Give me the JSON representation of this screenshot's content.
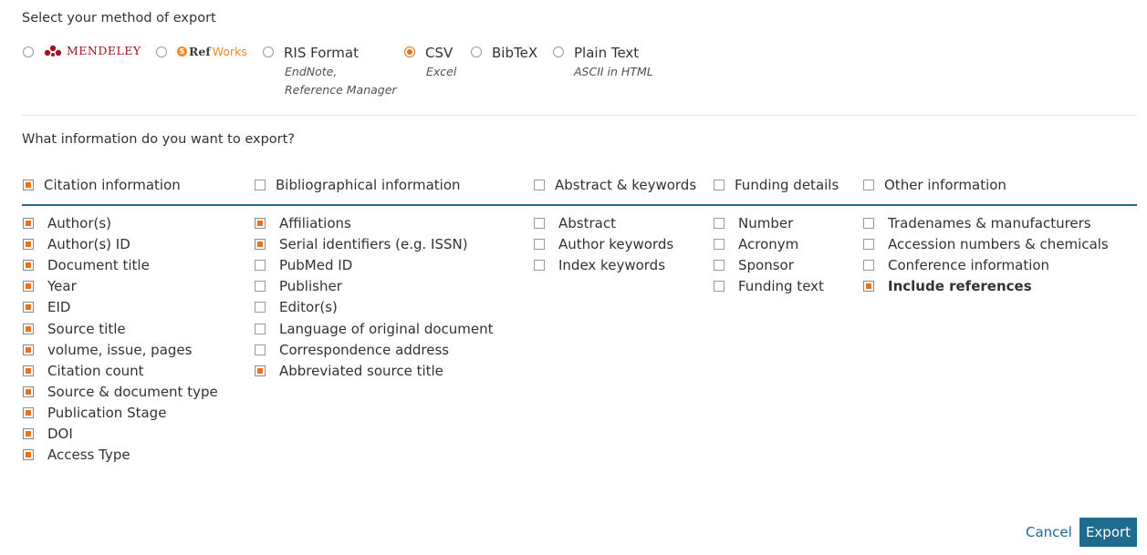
{
  "method_section": {
    "title": "Select your method of export",
    "methods": [
      {
        "id": "mendeley",
        "label": "MENDELEY",
        "selected": false
      },
      {
        "id": "refworks",
        "label_ref": "Ref",
        "label_works": "Works",
        "selected": false
      },
      {
        "id": "ris",
        "label": "RIS Format",
        "sub1": "EndNote,",
        "sub2": "Reference Manager",
        "selected": false
      },
      {
        "id": "csv",
        "label": "CSV",
        "sub1": "Excel",
        "selected": true
      },
      {
        "id": "bibtex",
        "label": "BibTeX",
        "selected": false
      },
      {
        "id": "plaintext",
        "label": "Plain Text",
        "sub1": "ASCII in HTML",
        "selected": false
      }
    ]
  },
  "info_section": {
    "title": "What information do you want to export?",
    "columns": [
      {
        "header": "Citation information",
        "checked": true,
        "items": [
          {
            "label": "Author(s)",
            "checked": true
          },
          {
            "label": "Author(s) ID",
            "checked": true
          },
          {
            "label": "Document title",
            "checked": true
          },
          {
            "label": "Year",
            "checked": true
          },
          {
            "label": "EID",
            "checked": true
          },
          {
            "label": "Source title",
            "checked": true
          },
          {
            "label": "volume, issue, pages",
            "checked": true
          },
          {
            "label": "Citation count",
            "checked": true
          },
          {
            "label": "Source & document type",
            "checked": true
          },
          {
            "label": "Publication Stage",
            "checked": true
          },
          {
            "label": "DOI",
            "checked": true
          },
          {
            "label": "Access Type",
            "checked": true
          }
        ]
      },
      {
        "header": "Bibliographical information",
        "checked": false,
        "items": [
          {
            "label": "Affiliations",
            "checked": true
          },
          {
            "label": "Serial identifiers (e.g. ISSN)",
            "checked": true
          },
          {
            "label": "PubMed ID",
            "checked": false
          },
          {
            "label": "Publisher",
            "checked": false
          },
          {
            "label": "Editor(s)",
            "checked": false
          },
          {
            "label": "Language of original document",
            "checked": false
          },
          {
            "label": "Correspondence address",
            "checked": false
          },
          {
            "label": "Abbreviated source title",
            "checked": true
          }
        ]
      },
      {
        "header": "Abstract & keywords",
        "checked": false,
        "items": [
          {
            "label": "Abstract",
            "checked": false
          },
          {
            "label": "Author keywords",
            "checked": false
          },
          {
            "label": "Index keywords",
            "checked": false
          }
        ]
      },
      {
        "header": "Funding details",
        "checked": false,
        "items": [
          {
            "label": "Number",
            "checked": false
          },
          {
            "label": "Acronym",
            "checked": false
          },
          {
            "label": "Sponsor",
            "checked": false
          },
          {
            "label": "Funding text",
            "checked": false
          }
        ]
      },
      {
        "header": "Other information",
        "checked": false,
        "items": [
          {
            "label": "Tradenames & manufacturers",
            "checked": false
          },
          {
            "label": "Accession numbers & chemicals",
            "checked": false
          },
          {
            "label": "Conference information",
            "checked": false
          },
          {
            "label": "Include references",
            "checked": true
          }
        ]
      }
    ]
  },
  "actions": {
    "cancel": "Cancel",
    "export": "Export"
  },
  "colors": {
    "accent": "#e9711c",
    "primary": "#1f6b8e"
  }
}
